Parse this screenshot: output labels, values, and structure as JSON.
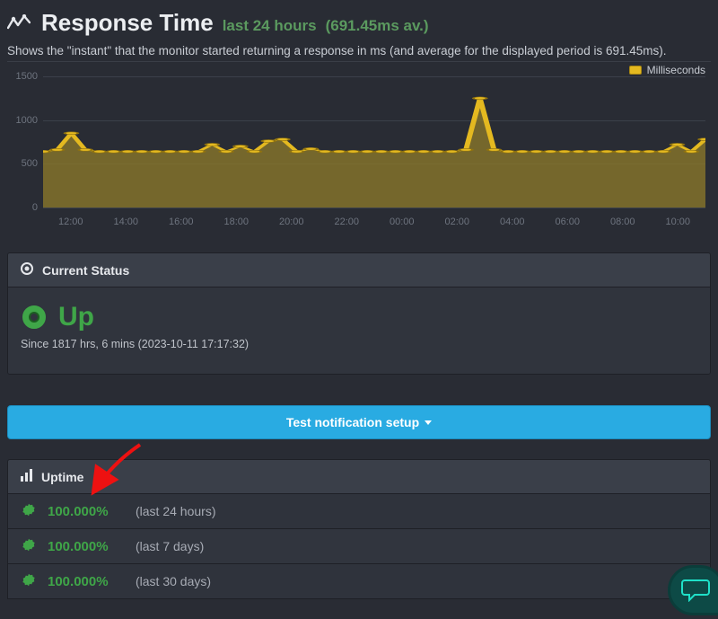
{
  "header": {
    "title": "Response Time",
    "period": "last 24 hours",
    "avg": "(691.45ms av.)",
    "description": "Shows the \"instant\" that the monitor started returning a response in ms (and average for the displayed period is 691.45ms)."
  },
  "chart_data": {
    "type": "area",
    "title": "Response Time",
    "xlabel": "",
    "ylabel": "",
    "ylim": [
      0,
      1500
    ],
    "legend": "Milliseconds",
    "x_ticks": [
      "12:00",
      "14:00",
      "16:00",
      "18:00",
      "20:00",
      "22:00",
      "00:00",
      "02:00",
      "04:00",
      "06:00",
      "08:00",
      "10:00"
    ],
    "y_ticks": [
      0,
      500,
      1000,
      1500
    ],
    "series": [
      {
        "name": "Milliseconds",
        "color": "#e4b920",
        "values": [
          640,
          660,
          850,
          660,
          640,
          640,
          640,
          640,
          640,
          640,
          640,
          640,
          720,
          640,
          700,
          640,
          760,
          780,
          640,
          670,
          640,
          640,
          640,
          640,
          640,
          640,
          640,
          640,
          640,
          640,
          660,
          1250,
          660,
          640,
          640,
          640,
          640,
          640,
          640,
          640,
          640,
          640,
          640,
          640,
          640,
          720,
          640,
          780
        ]
      }
    ]
  },
  "status": {
    "panel_title": "Current Status",
    "state": "Up",
    "since": "Since 1817 hrs, 6 mins (2023-10-11 17:17:32)"
  },
  "test_button": "Test notification setup",
  "uptime": {
    "panel_title": "Uptime",
    "rows": [
      {
        "value": "100.000%",
        "label": "(last 24 hours)"
      },
      {
        "value": "100.000%",
        "label": "(last 7 days)"
      },
      {
        "value": "100.000%",
        "label": "(last 30 days)"
      }
    ]
  }
}
